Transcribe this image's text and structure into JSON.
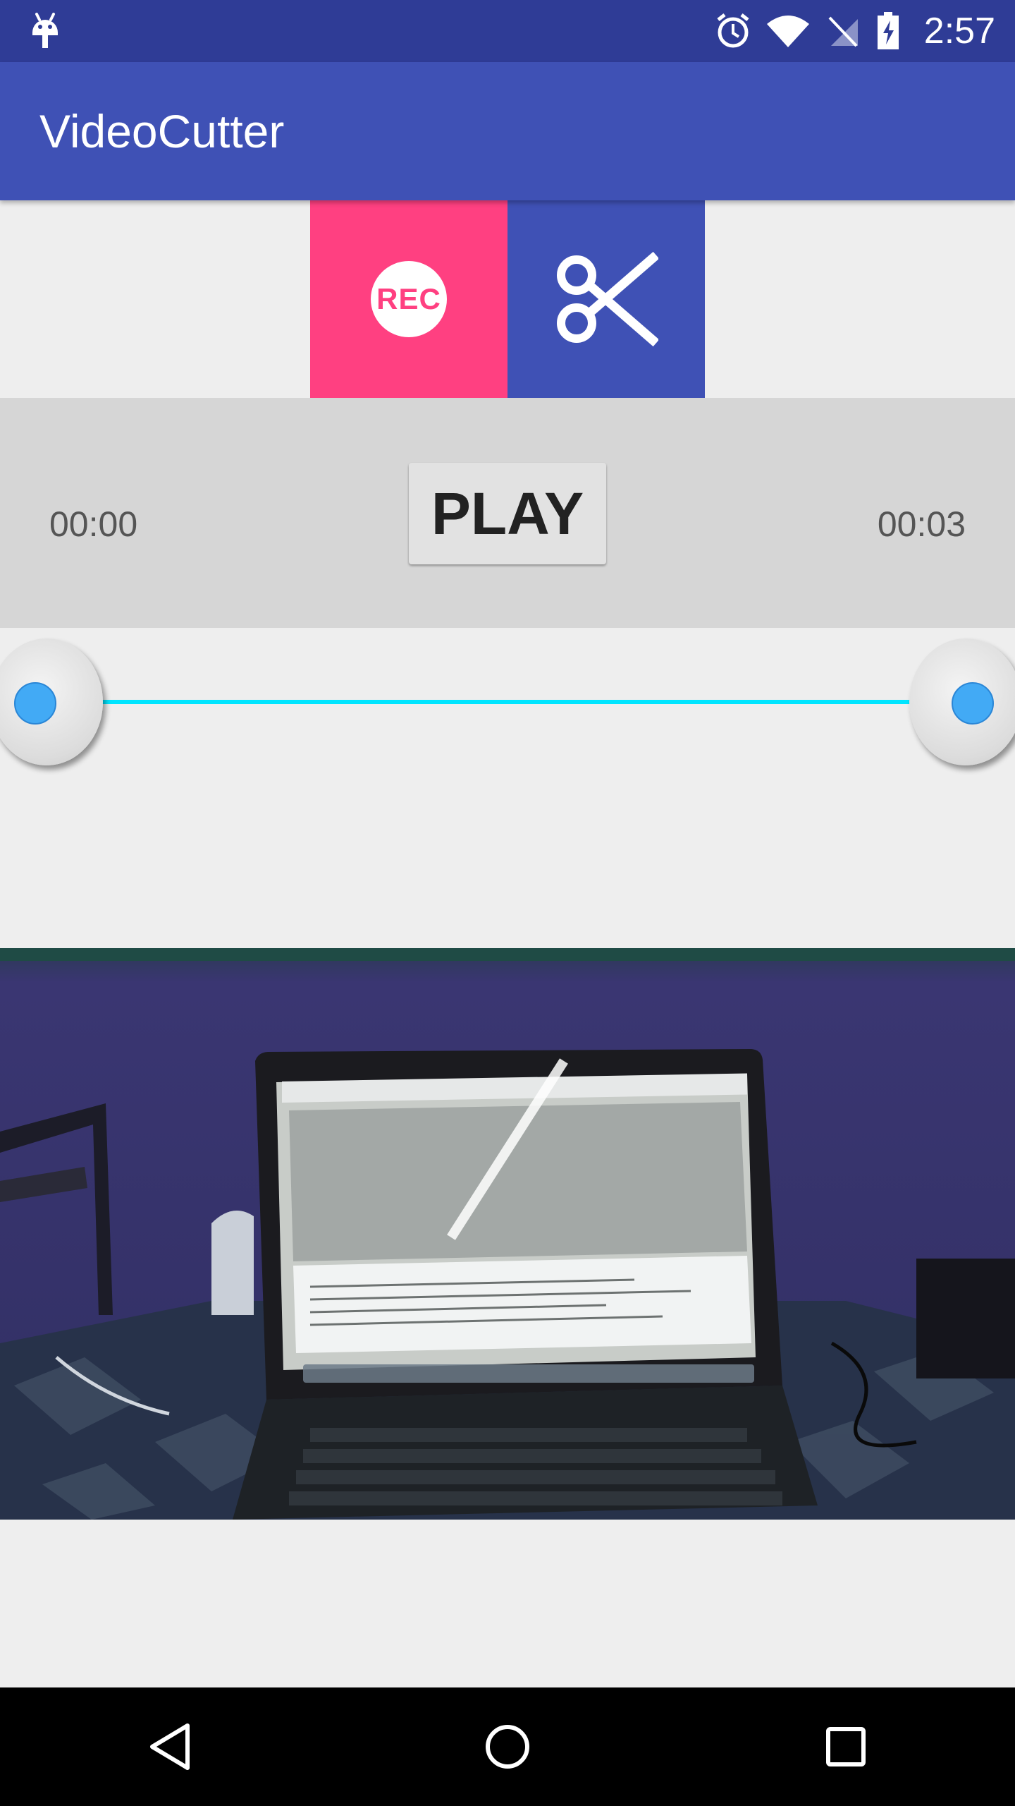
{
  "status_bar": {
    "time": "2:57",
    "icons": [
      "android-icon",
      "alarm-icon",
      "wifi-icon",
      "no-sim-icon",
      "battery-charging-icon"
    ]
  },
  "app_bar": {
    "title": "VideoCutter"
  },
  "actions": {
    "record_label": "REC",
    "record_icon": "record-icon",
    "cut_icon": "scissors-icon"
  },
  "player": {
    "play_label": "PLAY",
    "start_time": "00:00",
    "end_time": "00:03"
  },
  "range_slider": {
    "start_fraction": 0.0,
    "end_fraction": 1.0
  },
  "video": {
    "icon": "video-frame-thumbnail"
  },
  "nav_bar": {
    "icons": [
      "back-icon",
      "home-icon",
      "recents-icon"
    ]
  },
  "colors": {
    "status_bar": "#2f3c96",
    "primary": "#3f51b5",
    "accent": "#ff4081",
    "track": "#00e5ff",
    "thumb_dot": "#42aaf5"
  }
}
